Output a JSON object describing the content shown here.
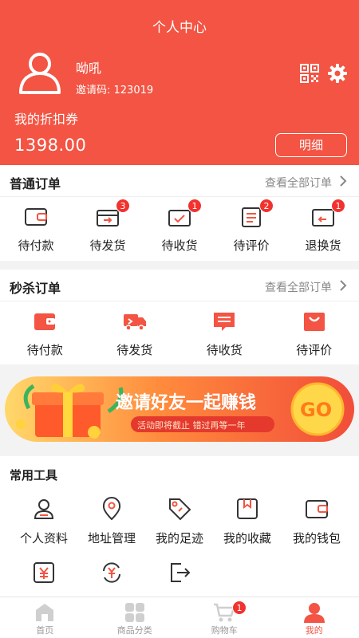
{
  "header": {
    "title": "个人中心",
    "username": "呦吼",
    "invite_code": "邀请码: 123019",
    "coupon_label": "我的折扣券",
    "coupon_value": "1398.00",
    "detail_button": "明细"
  },
  "normal_orders": {
    "title": "普通订单",
    "view_all": "查看全部订单",
    "items": [
      {
        "label": "待付款",
        "icon": "wallet-icon",
        "badge": ""
      },
      {
        "label": "待发货",
        "icon": "box-icon",
        "badge": "3"
      },
      {
        "label": "待收货",
        "icon": "receive-icon",
        "badge": "1"
      },
      {
        "label": "待评价",
        "icon": "review-icon",
        "badge": "2"
      },
      {
        "label": "退换货",
        "icon": "return-icon",
        "badge": "1"
      }
    ]
  },
  "flash_orders": {
    "title": "秒杀订单",
    "view_all": "查看全部订单",
    "items": [
      {
        "label": "待付款",
        "icon": "wallet-icon"
      },
      {
        "label": "待发货",
        "icon": "truck-icon"
      },
      {
        "label": "待收货",
        "icon": "message-icon"
      },
      {
        "label": "待评价",
        "icon": "bag-icon"
      }
    ]
  },
  "banner": {
    "headline": "邀请好友一起赚钱",
    "subline": "活动即将截止 错过再等一年",
    "go": "GO"
  },
  "tools": {
    "title": "常用工具",
    "items": [
      {
        "label": "个人资料",
        "icon": "user-icon"
      },
      {
        "label": "地址管理",
        "icon": "location-icon"
      },
      {
        "label": "我的足迹",
        "icon": "tag-icon"
      },
      {
        "label": "我的收藏",
        "icon": "bookmark-icon"
      },
      {
        "label": "我的钱包",
        "icon": "wallet-icon"
      },
      {
        "label": "",
        "icon": "yen-icon"
      },
      {
        "label": "",
        "icon": "exchange-icon"
      },
      {
        "label": "",
        "icon": "logout-icon"
      }
    ]
  },
  "tabbar": {
    "items": [
      {
        "label": "首页",
        "icon": "home-icon"
      },
      {
        "label": "商品分类",
        "icon": "category-icon"
      },
      {
        "label": "购物车",
        "icon": "cart-icon",
        "badge": "1"
      },
      {
        "label": "我的",
        "icon": "profile-icon"
      }
    ]
  },
  "colors": {
    "brand": "#f35443",
    "badge": "#f1322f"
  }
}
